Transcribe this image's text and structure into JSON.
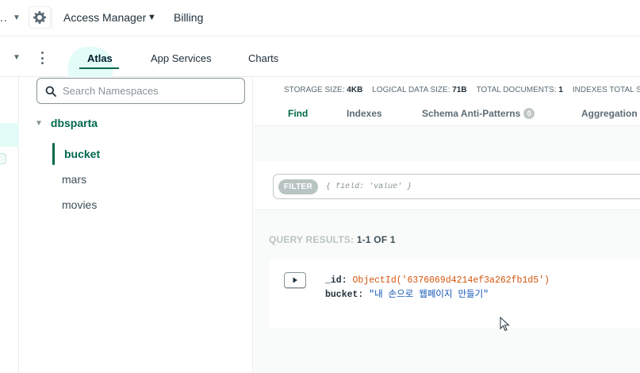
{
  "topbar": {
    "org_label": "..",
    "access_manager": "Access Manager",
    "billing": "Billing"
  },
  "nav": {
    "tabs": [
      {
        "label": "Atlas",
        "active": true
      },
      {
        "label": "App Services",
        "active": false
      },
      {
        "label": "Charts",
        "active": false
      }
    ]
  },
  "sidebar": {
    "search_placeholder": "Search Namespaces",
    "database": "dbsparta",
    "collections": [
      "bucket",
      "mars",
      "movies"
    ],
    "active_collection": "bucket"
  },
  "stats": {
    "storage_label": "STORAGE SIZE:",
    "storage_value": "4KB",
    "logical_label": "LOGICAL DATA SIZE:",
    "logical_value": "71B",
    "docs_label": "TOTAL DOCUMENTS:",
    "docs_value": "1",
    "indexes_label": "INDEXES TOTAL SIZE"
  },
  "subtabs": {
    "find": "Find",
    "indexes": "Indexes",
    "schema": "Schema Anti-Patterns",
    "schema_count": "0",
    "aggregation": "Aggregation"
  },
  "filter": {
    "label": "FILTER",
    "placeholder": "{ field: 'value' }"
  },
  "results": {
    "label": "QUERY RESULTS:",
    "range": "1-1 OF 1"
  },
  "document": {
    "id_key": "_id:",
    "id_value": "ObjectId('6376069d4214ef3a262fb1d5')",
    "field_key": "bucket:",
    "field_value": "\"내 손으로 웹페이지 만들기\""
  },
  "colors": {
    "brand_green": "#00684a",
    "mint": "#e3fcf7",
    "oid_orange": "#d4560f",
    "string_blue": "#1254b7"
  }
}
